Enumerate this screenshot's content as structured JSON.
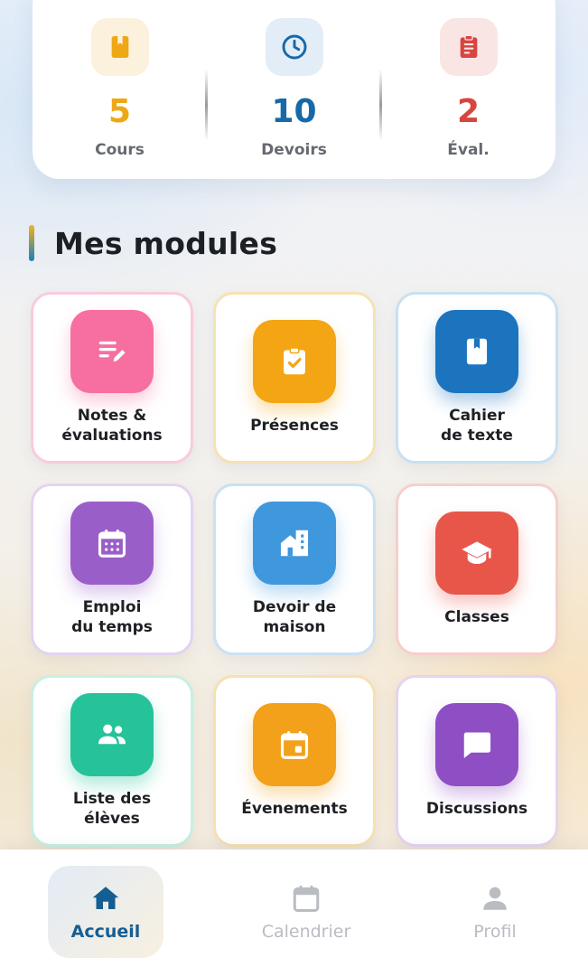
{
  "stats": [
    {
      "value": "5",
      "label": "Cours",
      "icon": "book-icon",
      "color": "#eea815",
      "tint": "#fbf1dc"
    },
    {
      "value": "10",
      "label": "Devoirs",
      "icon": "clock-icon",
      "color": "#1769a8",
      "tint": "#e3edf7"
    },
    {
      "value": "2",
      "label": "Éval.",
      "icon": "clipboard-list-icon",
      "color": "#d8453f",
      "tint": "#f8e5e4"
    }
  ],
  "section": {
    "title": "Mes modules"
  },
  "modules": [
    {
      "label": "Notes &\névaluations",
      "icon": "notes-edit-icon",
      "color": "#f76fa0",
      "border": "#f8cbdc"
    },
    {
      "label": "Présences",
      "icon": "clipboard-check-icon",
      "color": "#f4a514",
      "border": "#f7e2b3"
    },
    {
      "label": "Cahier\nde texte",
      "icon": "book-icon",
      "color": "#1b74bd",
      "border": "#c7e1f2"
    },
    {
      "label": "Emploi\ndu temps",
      "icon": "calendar-grid-icon",
      "color": "#9a5ec9",
      "border": "#e3d3f1"
    },
    {
      "label": "Devoir de\nmaison",
      "icon": "home-buildings-icon",
      "color": "#3f97dc",
      "border": "#c9e2f3"
    },
    {
      "label": "Classes",
      "icon": "graduation-cap-icon",
      "color": "#e8564a",
      "border": "#f6cfcb"
    },
    {
      "label": "Liste des\nélèves",
      "icon": "group-icon",
      "color": "#26c29a",
      "border": "#c7efe2"
    },
    {
      "label": "Évenements",
      "icon": "calendar-event-icon",
      "color": "#f3a11a",
      "border": "#f6e0b4"
    },
    {
      "label": "Discussions",
      "icon": "chat-bubble-icon",
      "color": "#8e4ec4",
      "border": "#e4d4f0"
    }
  ],
  "nav": [
    {
      "label": "Accueil",
      "icon": "home-icon",
      "active": true
    },
    {
      "label": "Calendrier",
      "icon": "calendar-icon",
      "active": false
    },
    {
      "label": "Profil",
      "icon": "person-icon",
      "active": false
    }
  ],
  "colors": {
    "nav_active": "#155e93",
    "nav_inactive": "#b9bcc1"
  }
}
